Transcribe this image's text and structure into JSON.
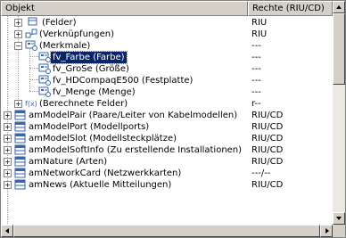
{
  "columns": {
    "object": "Objekt",
    "rights": "Rechte (RIU/CD)"
  },
  "rows": [
    {
      "label": "(Felder)",
      "rights": "RIU",
      "icon": "fields-icon",
      "toggle": "+"
    },
    {
      "label": "(Verknüpfungen)",
      "rights": "RIU",
      "icon": "links-icon",
      "toggle": "+"
    },
    {
      "label": "(Merkmale)",
      "rights": "---",
      "icon": "features-icon",
      "toggle": "−"
    },
    {
      "label": "fv_Farbe (Farbe)",
      "rights": "---",
      "icon": "feature-value-icon",
      "selected": true
    },
    {
      "label": "fv_GroSe (Größe)",
      "rights": "---",
      "icon": "feature-value-icon"
    },
    {
      "label": "fv_HDCompaqE500 (Festplatte)",
      "rights": "---",
      "icon": "feature-value-icon"
    },
    {
      "label": "fv_Menge (Menge)",
      "rights": "---",
      "icon": "feature-value-icon"
    },
    {
      "label": "(Berechnete Felder)",
      "rights": "r--",
      "icon": "calculated-fields-icon",
      "toggle": "+"
    },
    {
      "label": "amModelPair (Paare/Leiter von Kabelmodellen)",
      "rights": "RIU/CD",
      "icon": "table-icon",
      "toggle": "+"
    },
    {
      "label": "amModelPort (Modellports)",
      "rights": "RIU/CD",
      "icon": "table-icon",
      "toggle": "+"
    },
    {
      "label": "amModelSlot (Modellsteckplätze)",
      "rights": "RIU/CD",
      "icon": "table-icon",
      "toggle": "+"
    },
    {
      "label": "amModelSoftInfo (Zu erstellende Installationen)",
      "rights": "RIU/CD",
      "icon": "table-icon",
      "toggle": "+"
    },
    {
      "label": "amNature (Arten)",
      "rights": "RIU/CD",
      "icon": "table-icon",
      "toggle": "+"
    },
    {
      "label": "amNetworkCard (Netzwerkkarten)",
      "rights": "---/--",
      "icon": "table-icon",
      "toggle": "+"
    },
    {
      "label": "amNews (Aktuelle Mitteilungen)",
      "rights": "RIU/CD",
      "icon": "table-icon",
      "toggle": "+"
    }
  ],
  "calc_icon_text": "f(x)",
  "colors": {
    "selection": "#0a246a",
    "icon_blue": "#3a66a8",
    "window_face": "#d4d0c8"
  }
}
